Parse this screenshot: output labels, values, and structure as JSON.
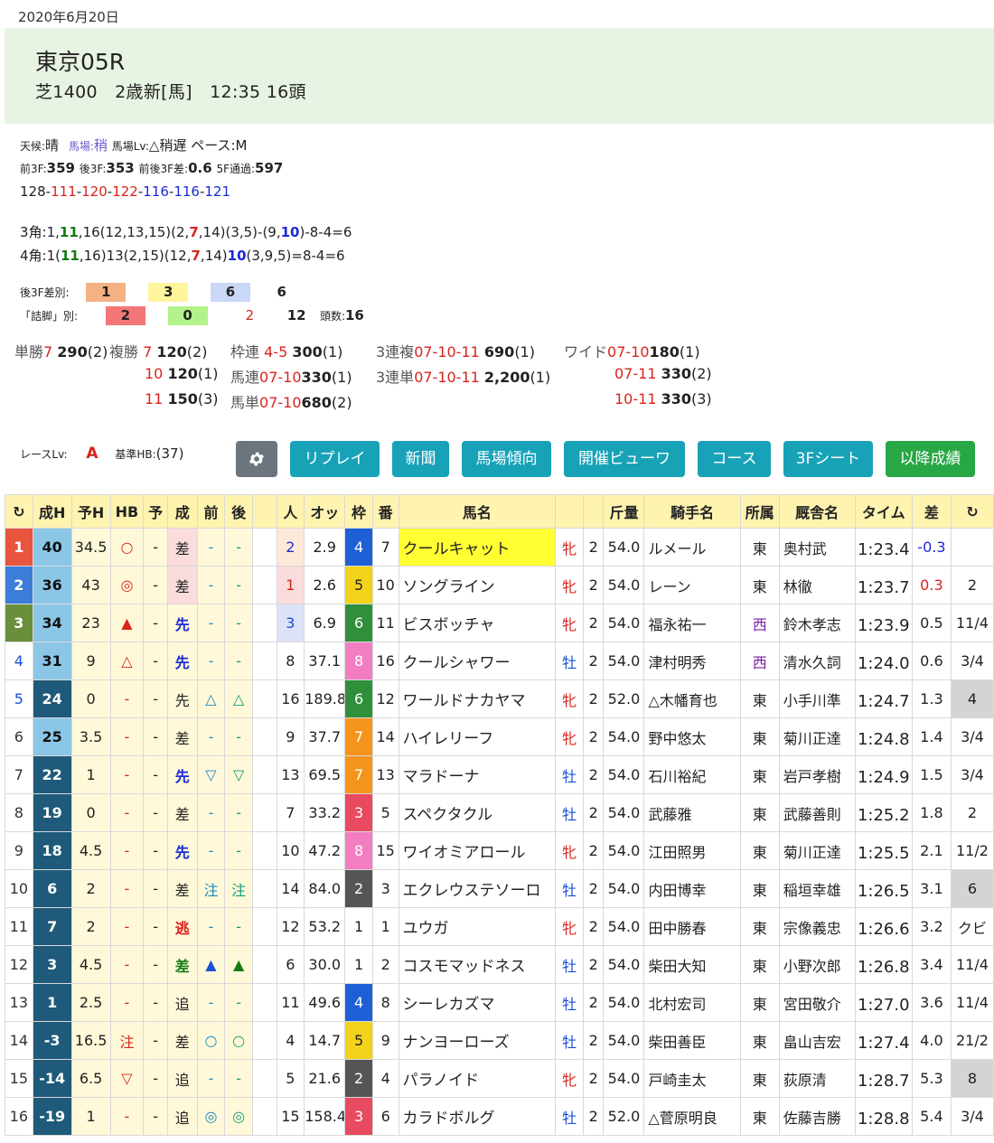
{
  "date": "2020年6月20日",
  "race": {
    "title": "東京05R",
    "sub": "芝1400　2歳新[馬]　12:35  16頭"
  },
  "cond": {
    "weather": "天候:",
    "weather_v": "晴",
    "track": "馬場:",
    "track_v": "稍",
    "track_lv": "馬場Lv:",
    "track_lv_v": "△稍遅",
    "pace": "ペース:M"
  },
  "split": {
    "f3": "前3F:",
    "f3v": "359",
    "l3": "後3F:",
    "l3v": "353",
    "diff": "前後3F差:",
    "diffv": "0.6",
    "f5": "5F通過:",
    "f5v": "597"
  },
  "laps": [
    "128",
    "111",
    "120",
    "122",
    "116",
    "116",
    "121"
  ],
  "corner3": "3角:1,11,16(12,13,15)(2,7,14)(3,5)-(9,10)-8-4=6",
  "corner4": "4角:1(11,16)13(2,15)(12,7,14)10(3,9,5)=8-4=6",
  "l3rank": {
    "label": "後3F差別:",
    "v": [
      "1",
      "3",
      "6",
      "6"
    ]
  },
  "tsume": {
    "label": "「詰脚」別:",
    "v": [
      "2",
      "0",
      "2",
      "12"
    ],
    "heads_label": "頭数:",
    "heads": "16"
  },
  "payout": {
    "tansho": "単勝",
    "tansho_n": "7",
    "tansho_v": "290",
    "tansho_p": "(2)",
    "fukusho": "複勝",
    "fuku": [
      {
        "n": "7",
        "v": "120",
        "p": "(2)"
      },
      {
        "n": "10",
        "v": "120",
        "p": "(1)"
      },
      {
        "n": "11",
        "v": "150",
        "p": "(3)"
      }
    ],
    "waku": "枠連",
    "waku_n": "4-5",
    "waku_v": "300",
    "waku_p": "(1)",
    "umaren": "馬連",
    "umaren_n": "07-10",
    "umaren_v": "330",
    "umaren_p": "(1)",
    "umatan": "馬単",
    "umatan_n": "07-10",
    "umatan_v": "680",
    "umatan_p": "(2)",
    "sanfuku": "3連複",
    "sanfuku_n": "07-10-11",
    "sanfuku_v": "690",
    "sanfuku_p": "(1)",
    "santan": "3連単",
    "santan_n": "07-10-11",
    "santan_v": "2,200",
    "santan_p": "(1)",
    "wide": "ワイド",
    "wides": [
      {
        "n": "07-10",
        "v": "180",
        "p": "(1)"
      },
      {
        "n": "07-11",
        "v": "330",
        "p": "(2)"
      },
      {
        "n": "10-11",
        "v": "330",
        "p": "(3)"
      }
    ]
  },
  "racelv": {
    "label": "レースLv:",
    "v": "A",
    "hb_label": "基準HB:",
    "hb": "(37)"
  },
  "buttons": [
    "リプレイ",
    "新聞",
    "馬場傾向",
    "開催ビューワ",
    "コース",
    "3Fシート",
    "以降成績"
  ],
  "headers": [
    "成H",
    "予H",
    "HB",
    "予",
    "成",
    "前",
    "後",
    "",
    "人",
    "オッ",
    "枠",
    "番",
    "馬名",
    "",
    "",
    "斤量",
    "騎手名",
    "所属",
    "厩舎名",
    "タイム",
    "差"
  ],
  "rows": [
    [
      "1",
      "40",
      "34.5",
      "○",
      "-",
      "差",
      "-",
      "-",
      "2",
      "2.9",
      "4",
      "7",
      "クールキャット",
      "牝",
      "2",
      "54.0",
      "ルメール",
      "東",
      "奥村武",
      "1:23.4",
      "-0.3",
      ""
    ],
    [
      "2",
      "36",
      "43",
      "◎",
      "-",
      "差",
      "-",
      "-",
      "1",
      "2.6",
      "5",
      "10",
      "ソングライン",
      "牝",
      "2",
      "54.0",
      "レーン",
      "東",
      "林徹",
      "1:23.7",
      "0.3",
      "2"
    ],
    [
      "3",
      "34",
      "23",
      "▲",
      "-",
      "先",
      "-",
      "-",
      "3",
      "6.9",
      "6",
      "11",
      "ビスボッチャ",
      "牝",
      "2",
      "54.0",
      "福永祐一",
      "西",
      "鈴木孝志",
      "1:23.9",
      "0.5",
      "11/4"
    ],
    [
      "4",
      "31",
      "9",
      "△",
      "-",
      "先",
      "-",
      "-",
      "8",
      "37.1",
      "8",
      "16",
      "クールシャワー",
      "牡",
      "2",
      "54.0",
      "津村明秀",
      "西",
      "清水久詞",
      "1:24.0",
      "0.6",
      "3/4"
    ],
    [
      "5",
      "24",
      "0",
      "-",
      "-",
      "先",
      "△",
      "△",
      "16",
      "189.8",
      "6",
      "12",
      "ワールドナカヤマ",
      "牝",
      "2",
      "52.0",
      "△木幡育也",
      "東",
      "小手川準",
      "1:24.7",
      "1.3",
      "4"
    ],
    [
      "6",
      "25",
      "3.5",
      "-",
      "-",
      "差",
      "-",
      "-",
      "9",
      "37.7",
      "7",
      "14",
      "ハイレリーフ",
      "牝",
      "2",
      "54.0",
      "野中悠太",
      "東",
      "菊川正達",
      "1:24.8",
      "1.4",
      "3/4"
    ],
    [
      "7",
      "22",
      "1",
      "-",
      "-",
      "先",
      "▽",
      "▽",
      "13",
      "69.5",
      "7",
      "13",
      "マラドーナ",
      "牡",
      "2",
      "54.0",
      "石川裕紀",
      "東",
      "岩戸孝樹",
      "1:24.9",
      "1.5",
      "3/4"
    ],
    [
      "8",
      "19",
      "0",
      "-",
      "-",
      "差",
      "-",
      "-",
      "7",
      "33.2",
      "3",
      "5",
      "スペクタクル",
      "牡",
      "2",
      "54.0",
      "武藤雅",
      "東",
      "武藤善則",
      "1:25.2",
      "1.8",
      "2"
    ],
    [
      "9",
      "18",
      "4.5",
      "-",
      "-",
      "先",
      "-",
      "-",
      "10",
      "47.2",
      "8",
      "15",
      "ワイオミアロール",
      "牝",
      "2",
      "54.0",
      "江田照男",
      "東",
      "菊川正達",
      "1:25.5",
      "2.1",
      "11/2"
    ],
    [
      "10",
      "6",
      "2",
      "-",
      "-",
      "差",
      "注",
      "注",
      "14",
      "84.0",
      "2",
      "3",
      "エクレウステソーロ",
      "牡",
      "2",
      "54.0",
      "内田博幸",
      "東",
      "稲垣幸雄",
      "1:26.5",
      "3.1",
      "6"
    ],
    [
      "11",
      "7",
      "2",
      "-",
      "-",
      "逃",
      "-",
      "-",
      "12",
      "53.2",
      "1",
      "1",
      "ユウガ",
      "牝",
      "2",
      "54.0",
      "田中勝春",
      "東",
      "宗像義忠",
      "1:26.6",
      "3.2",
      "クビ"
    ],
    [
      "12",
      "3",
      "4.5",
      "-",
      "-",
      "差",
      "▲",
      "▲",
      "6",
      "30.0",
      "1",
      "2",
      "コスモマッドネス",
      "牡",
      "2",
      "54.0",
      "柴田大知",
      "東",
      "小野次郎",
      "1:26.8",
      "3.4",
      "11/4"
    ],
    [
      "13",
      "1",
      "2.5",
      "-",
      "-",
      "追",
      "-",
      "-",
      "11",
      "49.6",
      "4",
      "8",
      "シーレカズマ",
      "牡",
      "2",
      "54.0",
      "北村宏司",
      "東",
      "宮田敬介",
      "1:27.0",
      "3.6",
      "11/4"
    ],
    [
      "14",
      "-3",
      "16.5",
      "注",
      "-",
      "差",
      "○",
      "○",
      "4",
      "14.7",
      "5",
      "9",
      "ナンヨーローズ",
      "牡",
      "2",
      "54.0",
      "柴田善臣",
      "東",
      "畠山吉宏",
      "1:27.4",
      "4.0",
      "21/2"
    ],
    [
      "15",
      "-14",
      "6.5",
      "▽",
      "-",
      "追",
      "-",
      "-",
      "5",
      "21.6",
      "2",
      "4",
      "パラノイド",
      "牝",
      "2",
      "54.0",
      "戸崎圭太",
      "東",
      "荻原清",
      "1:28.7",
      "5.3",
      "8"
    ],
    [
      "16",
      "-19",
      "1",
      "-",
      "-",
      "追",
      "◎",
      "◎",
      "15",
      "158.4",
      "3",
      "6",
      "カラドボルグ",
      "牡",
      "2",
      "52.0",
      "△菅原明良",
      "東",
      "佐藤吉勝",
      "1:28.8",
      "5.4",
      "3/4"
    ]
  ]
}
